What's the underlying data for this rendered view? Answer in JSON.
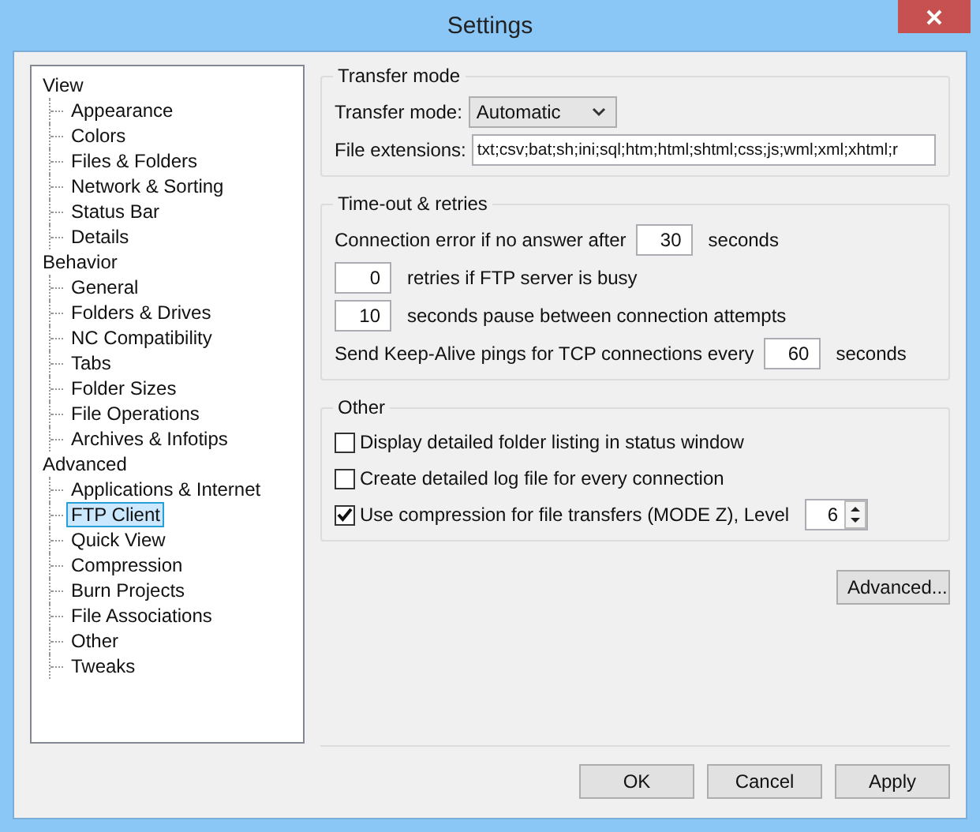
{
  "window": {
    "title": "Settings"
  },
  "tree": [
    {
      "label": "View",
      "selected": false,
      "children": [
        {
          "label": "Appearance",
          "selected": false
        },
        {
          "label": "Colors",
          "selected": false
        },
        {
          "label": "Files & Folders",
          "selected": false
        },
        {
          "label": "Network & Sorting",
          "selected": false
        },
        {
          "label": "Status Bar",
          "selected": false
        },
        {
          "label": "Details",
          "selected": false
        }
      ]
    },
    {
      "label": "Behavior",
      "selected": false,
      "children": [
        {
          "label": "General",
          "selected": false
        },
        {
          "label": "Folders & Drives",
          "selected": false
        },
        {
          "label": "NC Compatibility",
          "selected": false
        },
        {
          "label": "Tabs",
          "selected": false
        },
        {
          "label": "Folder Sizes",
          "selected": false
        },
        {
          "label": "File Operations",
          "selected": false
        },
        {
          "label": "Archives & Infotips",
          "selected": false
        }
      ]
    },
    {
      "label": "Advanced",
      "selected": false,
      "children": [
        {
          "label": "Applications & Internet",
          "selected": false
        },
        {
          "label": "FTP Client",
          "selected": true
        },
        {
          "label": "Quick View",
          "selected": false
        },
        {
          "label": "Compression",
          "selected": false
        },
        {
          "label": "Burn Projects",
          "selected": false
        },
        {
          "label": "File Associations",
          "selected": false
        },
        {
          "label": "Other",
          "selected": false
        },
        {
          "label": "Tweaks",
          "selected": false
        }
      ]
    }
  ],
  "transfer_mode": {
    "title": "Transfer mode",
    "mode_label": "Transfer mode:",
    "mode_value": "Automatic",
    "extensions_label": "File extensions:",
    "extensions_value": "txt;csv;bat;sh;ini;sql;htm;html;shtml;css;js;wml;xml;xhtml;r"
  },
  "timeouts": {
    "title": "Time-out & retries",
    "rows": [
      {
        "kind": "before",
        "before": "Connection error if no answer after",
        "value": "30",
        "after": "seconds"
      },
      {
        "kind": "lead",
        "value": "0",
        "after": "retries if FTP server is busy"
      },
      {
        "kind": "lead",
        "value": "10",
        "after": "seconds pause between connection attempts"
      },
      {
        "kind": "before",
        "before": "Send Keep-Alive pings for TCP connections every",
        "value": "60",
        "after": "seconds"
      }
    ]
  },
  "other": {
    "title": "Other",
    "options": [
      {
        "label": "Display detailed folder listing in status window",
        "checked": false
      },
      {
        "label": "Create detailed log file for every connection",
        "checked": false
      },
      {
        "label": "Use compression for file transfers (MODE Z), Level",
        "checked": true,
        "spinner_value": "6"
      }
    ]
  },
  "advanced_button": "Advanced...",
  "buttons": [
    "OK",
    "Cancel",
    "Apply"
  ]
}
